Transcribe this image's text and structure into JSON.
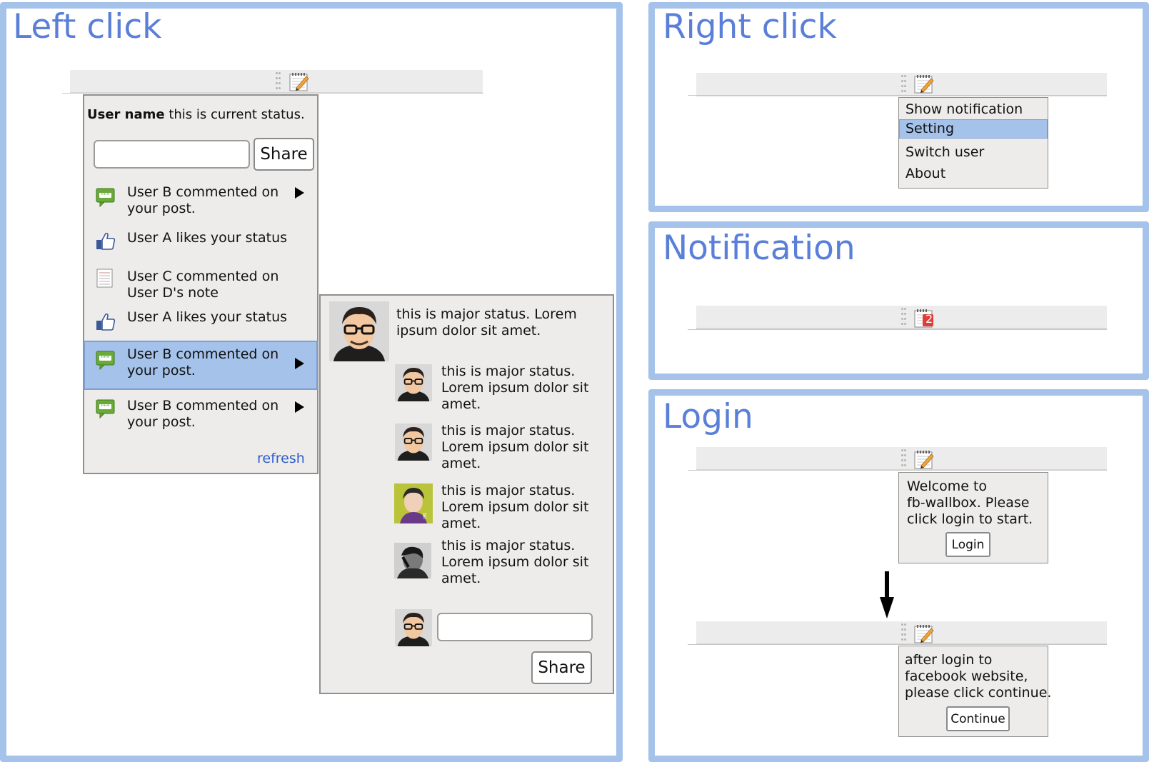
{
  "panels": {
    "left_click": "Left click",
    "right_click": "Right click",
    "notification": "Notification",
    "login": "Login"
  },
  "status_popup": {
    "user_name": "User name",
    "current_status": " this is current status.",
    "share_label": "Share",
    "refresh_label": "refresh",
    "items": [
      {
        "icon": "comment-icon",
        "line1": "User B commented on",
        "line2": "your post."
      },
      {
        "icon": "like-icon",
        "line1": "User A likes your status",
        "line2": ""
      },
      {
        "icon": "note-icon",
        "line1": "User C commented on",
        "line2": "User D's note"
      },
      {
        "icon": "like-icon",
        "line1": "User A likes your status",
        "line2": ""
      },
      {
        "icon": "comment-icon",
        "line1": "User B commented on",
        "line2": "your post."
      },
      {
        "icon": "comment-icon",
        "line1": "User B commented on",
        "line2": "your post."
      }
    ]
  },
  "detail_popup": {
    "major": {
      "line1": "this is major status.  Lorem",
      "line2": "ipsum dolor sit amet."
    },
    "comments": [
      {
        "line1": "this is major status.",
        "line2": "Lorem ipsum dolor sit",
        "line3": "amet."
      },
      {
        "line1": "this is major status.",
        "line2": "Lorem ipsum dolor sit",
        "line3": "amet."
      },
      {
        "line1": "this is major status.",
        "line2": "Lorem ipsum dolor sit",
        "line3": "amet."
      },
      {
        "line1": "this is major status.",
        "line2": "Lorem ipsum dolor sit",
        "line3": "amet."
      }
    ],
    "share_label": "Share"
  },
  "context_menu": {
    "items": [
      "Show notification",
      "Setting",
      "Switch user",
      "About"
    ],
    "selected": "Setting"
  },
  "notification_badge": "2",
  "login_popup": {
    "line1": "Welcome to",
    "line2": "fb-wallbox. Please",
    "line3": "click login to start.",
    "button": "Login"
  },
  "continue_popup": {
    "line1": "after login to",
    "line2": "facebook website,",
    "line3": "please click continue.",
    "button": "Continue"
  },
  "colors": {
    "panel_border": "#a4c2ea",
    "title": "#5a7fd9",
    "highlight": "#a4c2ea",
    "link": "#2f5ec8",
    "badge": "#e03c3c",
    "comment_icon": "#6aaa3a",
    "like_icon": "#3b5998"
  }
}
